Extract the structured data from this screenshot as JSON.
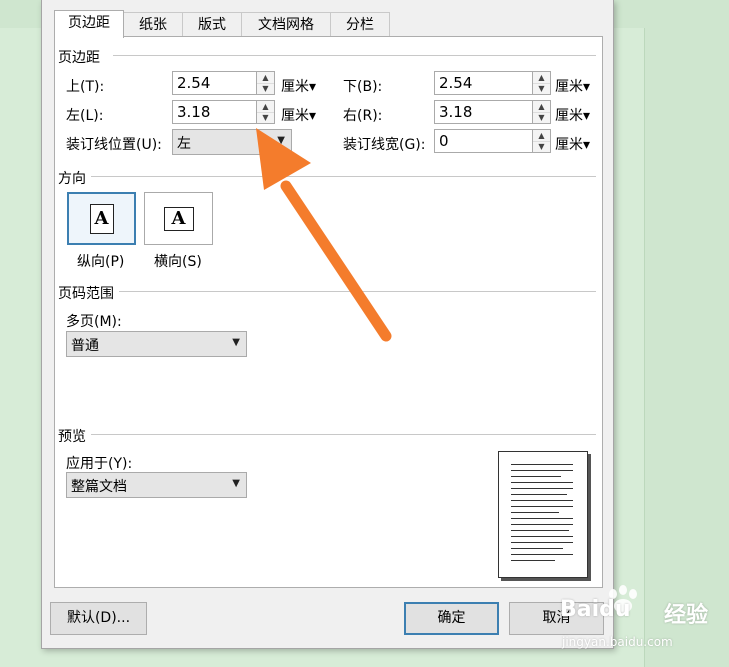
{
  "tabs": [
    "页边距",
    "纸张",
    "版式",
    "文档网格",
    "分栏"
  ],
  "margins": {
    "section_title": "页边距",
    "top": {
      "label": "上(T):",
      "value": "2.54",
      "unit": "厘米"
    },
    "bottom": {
      "label": "下(B):",
      "value": "2.54",
      "unit": "厘米"
    },
    "left": {
      "label": "左(L):",
      "value": "3.18",
      "unit": "厘米"
    },
    "right": {
      "label": "右(R):",
      "value": "3.18",
      "unit": "厘米"
    },
    "gutter_position": {
      "label": "装订线位置(U):",
      "value": "左"
    },
    "gutter": {
      "label": "装订线宽(G):",
      "value": "0",
      "unit": "厘米"
    }
  },
  "orientation": {
    "section_title": "方向",
    "portrait_label": "纵向(P)",
    "landscape_label": "横向(S)",
    "selected": "portrait",
    "icon_letter": "A"
  },
  "pages": {
    "section_title": "页码范围",
    "multiple_label": "多页(M):",
    "multiple_value": "普通"
  },
  "preview": {
    "section_title": "预览",
    "apply_label": "应用于(Y):",
    "apply_value": "整篇文档"
  },
  "buttons": {
    "default": "默认(D)...",
    "ok": "确定",
    "cancel": "取消"
  },
  "watermark": {
    "brand": "Baidu",
    "brand_cn": "经验",
    "url": "jingyan.baidu.com"
  },
  "colors": {
    "background": "#cfe6cf",
    "annotation_arrow": "#f47c2c",
    "selection": "#3c7fb1"
  }
}
